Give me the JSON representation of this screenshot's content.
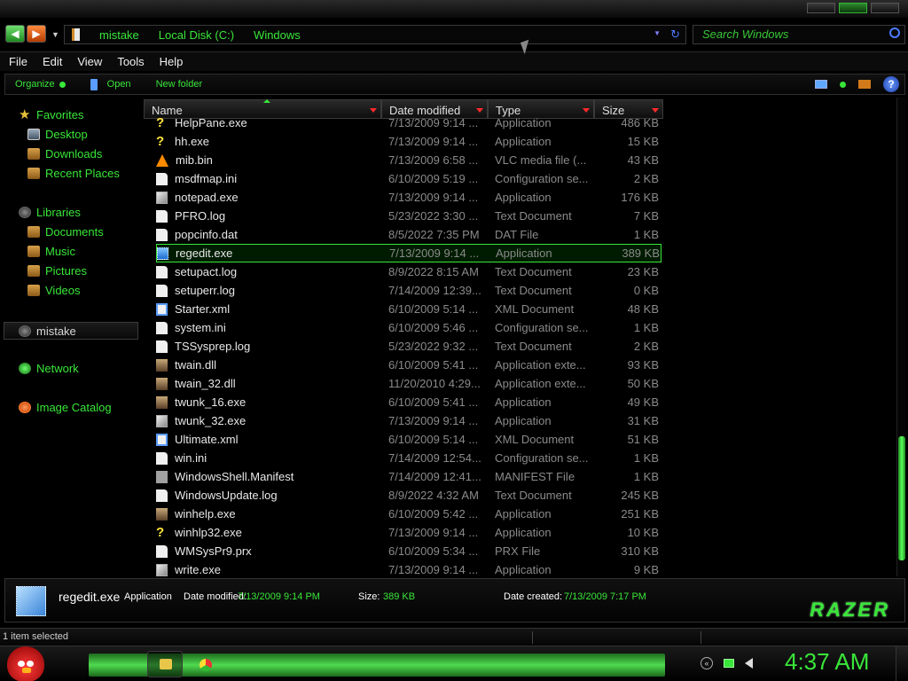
{
  "address": {
    "crumbs": [
      "mistake",
      "Local Disk (C:)",
      "Windows"
    ]
  },
  "search": {
    "placeholder": "Search Windows"
  },
  "menu": [
    "File",
    "Edit",
    "View",
    "Tools",
    "Help"
  ],
  "commands": {
    "organize": "Organize",
    "open": "Open",
    "new_folder": "New folder"
  },
  "nav": {
    "favorites": "Favorites",
    "favorites_items": [
      "Desktop",
      "Downloads",
      "Recent Places"
    ],
    "libraries": "Libraries",
    "libraries_items": [
      "Documents",
      "Music",
      "Pictures",
      "Videos"
    ],
    "homegroup_user": "mistake",
    "network": "Network",
    "image_catalog": "Image Catalog"
  },
  "columns": {
    "name": "Name",
    "date": "Date modified",
    "type": "Type",
    "size": "Size"
  },
  "files": [
    {
      "name": "HelpPane.exe",
      "date": "7/13/2009 9:14 ...",
      "type": "Application",
      "size": "486 KB",
      "icon": "help-icon"
    },
    {
      "name": "hh.exe",
      "date": "7/13/2009 9:14 ...",
      "type": "Application",
      "size": "15 KB",
      "icon": "help-icon"
    },
    {
      "name": "mib.bin",
      "date": "7/13/2009 6:58 ...",
      "type": "VLC media file (...",
      "size": "43 KB",
      "icon": "vlc-icon"
    },
    {
      "name": "msdfmap.ini",
      "date": "6/10/2009 5:19 ...",
      "type": "Configuration se...",
      "size": "2 KB",
      "icon": "config-file-icon"
    },
    {
      "name": "notepad.exe",
      "date": "7/13/2009 9:14 ...",
      "type": "Application",
      "size": "176 KB",
      "icon": "notepad-icon"
    },
    {
      "name": "PFRO.log",
      "date": "5/23/2022 3:30 ...",
      "type": "Text Document",
      "size": "7 KB",
      "icon": "text-file-icon"
    },
    {
      "name": "popcinfo.dat",
      "date": "8/5/2022 7:35 PM",
      "type": "DAT File",
      "size": "1 KB",
      "icon": "text-file-icon"
    },
    {
      "name": "regedit.exe",
      "date": "7/13/2009 9:14 ...",
      "type": "Application",
      "size": "389 KB",
      "icon": "regedit-icon"
    },
    {
      "name": "setupact.log",
      "date": "8/9/2022 8:15 AM",
      "type": "Text Document",
      "size": "23 KB",
      "icon": "text-file-icon"
    },
    {
      "name": "setuperr.log",
      "date": "7/14/2009 12:39...",
      "type": "Text Document",
      "size": "0 KB",
      "icon": "text-file-icon"
    },
    {
      "name": "Starter.xml",
      "date": "6/10/2009 5:14 ...",
      "type": "XML Document",
      "size": "48 KB",
      "icon": "xml-file-icon"
    },
    {
      "name": "system.ini",
      "date": "6/10/2009 5:46 ...",
      "type": "Configuration se...",
      "size": "1 KB",
      "icon": "config-file-icon"
    },
    {
      "name": "TSSysprep.log",
      "date": "5/23/2022 9:32 ...",
      "type": "Text Document",
      "size": "2 KB",
      "icon": "text-file-icon"
    },
    {
      "name": "twain.dll",
      "date": "6/10/2009 5:41 ...",
      "type": "Application exte...",
      "size": "93 KB",
      "icon": "dll-icon"
    },
    {
      "name": "twain_32.dll",
      "date": "11/20/2010 4:29...",
      "type": "Application exte...",
      "size": "50 KB",
      "icon": "dll-icon"
    },
    {
      "name": "twunk_16.exe",
      "date": "6/10/2009 5:41 ...",
      "type": "Application",
      "size": "49 KB",
      "icon": "dll-icon"
    },
    {
      "name": "twunk_32.exe",
      "date": "7/13/2009 9:14 ...",
      "type": "Application",
      "size": "31 KB",
      "icon": "app-icon"
    },
    {
      "name": "Ultimate.xml",
      "date": "6/10/2009 5:14 ...",
      "type": "XML Document",
      "size": "51 KB",
      "icon": "xml-file-icon"
    },
    {
      "name": "win.ini",
      "date": "7/14/2009 12:54...",
      "type": "Configuration se...",
      "size": "1 KB",
      "icon": "config-file-icon"
    },
    {
      "name": "WindowsShell.Manifest",
      "date": "7/14/2009 12:41...",
      "type": "MANIFEST File",
      "size": "1 KB",
      "icon": "generic-file-icon"
    },
    {
      "name": "WindowsUpdate.log",
      "date": "8/9/2022 4:32 AM",
      "type": "Text Document",
      "size": "245 KB",
      "icon": "text-file-icon"
    },
    {
      "name": "winhelp.exe",
      "date": "6/10/2009 5:42 ...",
      "type": "Application",
      "size": "251 KB",
      "icon": "dll-icon"
    },
    {
      "name": "winhlp32.exe",
      "date": "7/13/2009 9:14 ...",
      "type": "Application",
      "size": "10 KB",
      "icon": "help-icon"
    },
    {
      "name": "WMSysPr9.prx",
      "date": "6/10/2009 5:34 ...",
      "type": "PRX File",
      "size": "310 KB",
      "icon": "text-file-icon"
    },
    {
      "name": "write.exe",
      "date": "7/13/2009 9:14 ...",
      "type": "Application",
      "size": "9 KB",
      "icon": "app-icon"
    }
  ],
  "selected_index": 7,
  "details": {
    "name": "regedit.exe",
    "type": "Application",
    "date_modified_label": "Date modified:",
    "date_modified": "7/13/2009 9:14 PM",
    "size_label": "Size:",
    "size": "389 KB",
    "date_created_label": "Date created:",
    "date_created": "7/13/2009 7:17 PM",
    "brand": "RAZER"
  },
  "status": {
    "text": "1 item selected"
  },
  "taskbar": {
    "clock": "4:37 AM"
  },
  "colors": {
    "accent": "#39e639",
    "background": "#000000"
  }
}
